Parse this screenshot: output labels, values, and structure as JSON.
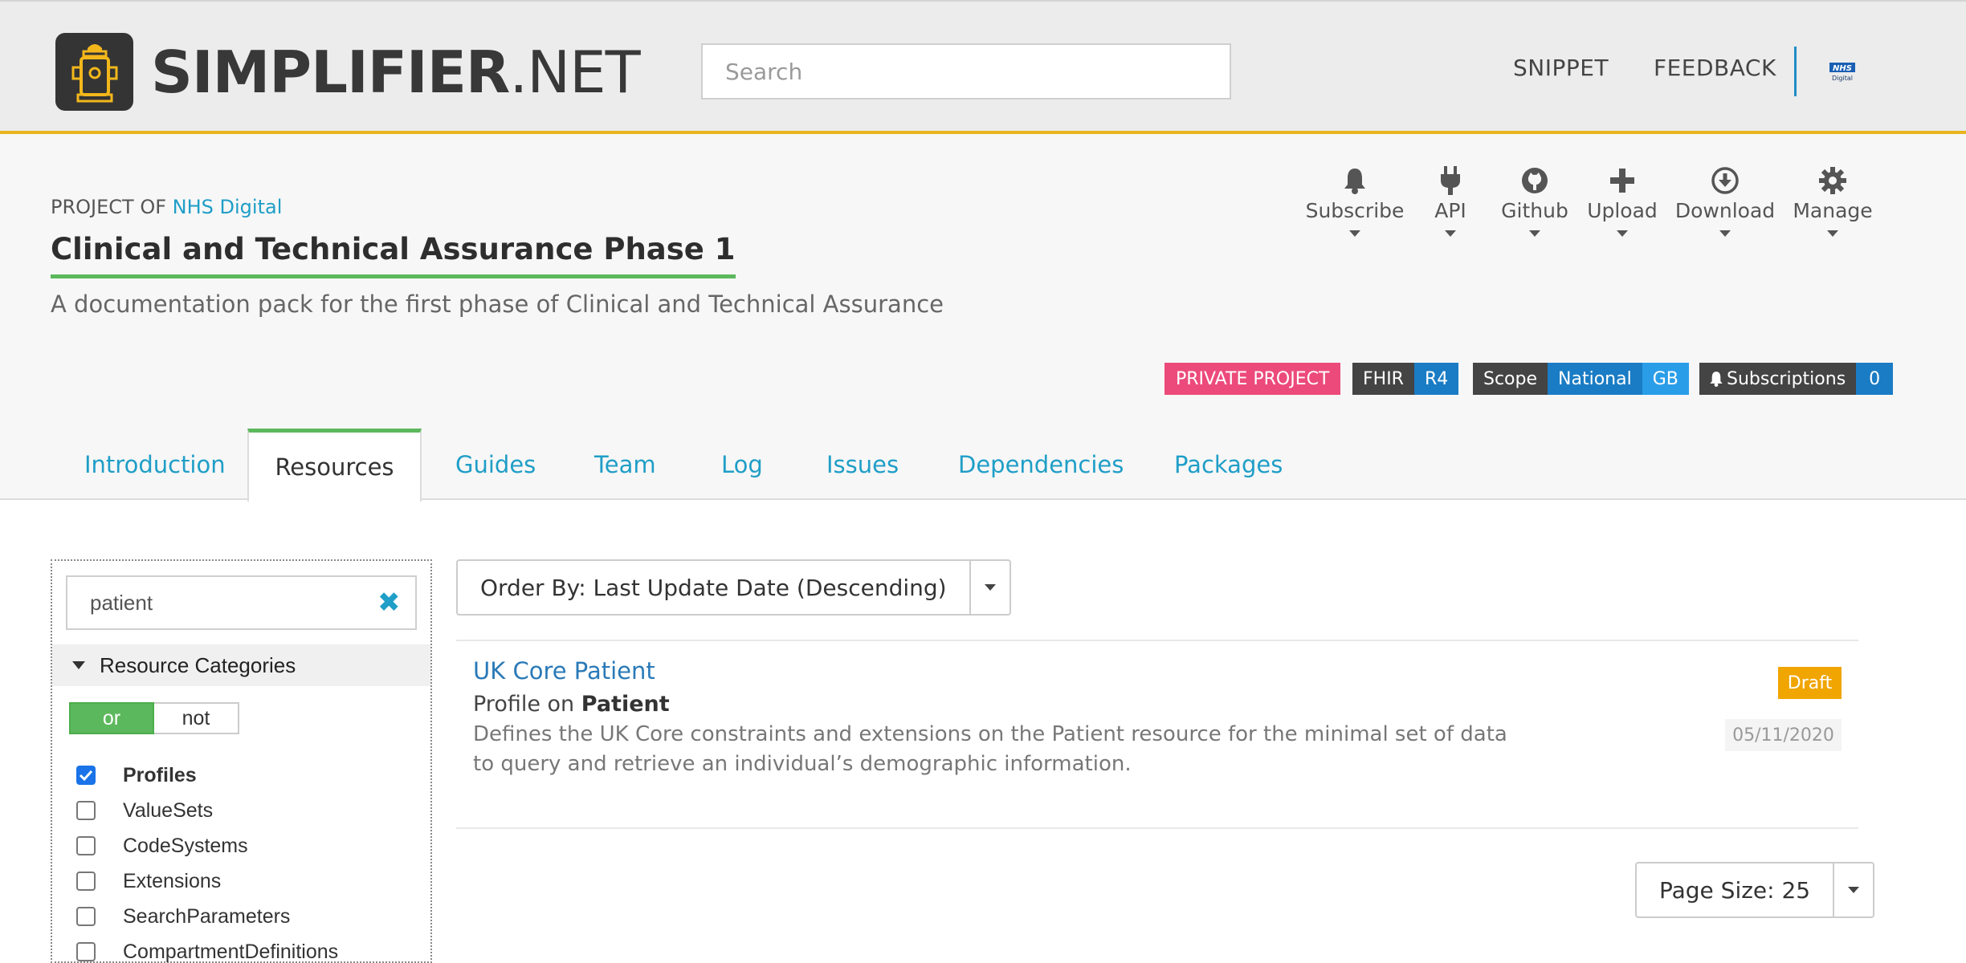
{
  "header": {
    "logo_text_bold": "SIMPLIFIER",
    "logo_text_rest": ".NET",
    "search_placeholder": "Search",
    "nav": {
      "snippet": "SNIPPET",
      "feedback": "FEEDBACK"
    },
    "org_logo_text": "NHS Digital"
  },
  "project": {
    "label_prefix": "PROJECT OF",
    "org_name": "NHS Digital",
    "title": "Clinical and Technical Assurance Phase 1",
    "description": "A documentation pack for the first phase of Clinical and Technical Assurance"
  },
  "actions": [
    {
      "label": "Subscribe",
      "icon": "bell-icon"
    },
    {
      "label": "API",
      "icon": "plug-icon"
    },
    {
      "label": "Github",
      "icon": "github-icon"
    },
    {
      "label": "Upload",
      "icon": "plus-icon"
    },
    {
      "label": "Download",
      "icon": "download-icon"
    },
    {
      "label": "Manage",
      "icon": "gear-icon"
    }
  ],
  "badges": {
    "private": "PRIVATE PROJECT",
    "fhir": {
      "label": "FHIR",
      "value": "R4"
    },
    "scope": {
      "label": "Scope",
      "value": "National",
      "extra": "GB"
    },
    "subscriptions": {
      "label": "Subscriptions",
      "value": "0"
    }
  },
  "tabs": [
    {
      "label": "Introduction"
    },
    {
      "label": "Resources",
      "active": true
    },
    {
      "label": "Guides"
    },
    {
      "label": "Team"
    },
    {
      "label": "Log"
    },
    {
      "label": "Issues"
    },
    {
      "label": "Dependencies"
    },
    {
      "label": "Packages"
    }
  ],
  "filter": {
    "query": "patient",
    "categories_heading": "Resource Categories",
    "toggle": {
      "on": "or",
      "off": "not"
    },
    "categories": [
      {
        "label": "Profiles",
        "checked": true
      },
      {
        "label": "ValueSets",
        "checked": false
      },
      {
        "label": "CodeSystems",
        "checked": false
      },
      {
        "label": "Extensions",
        "checked": false
      },
      {
        "label": "SearchParameters",
        "checked": false
      },
      {
        "label": "CompartmentDefinitions",
        "checked": false
      }
    ]
  },
  "results": {
    "order_by": "Order By: Last Update Date (Descending)",
    "items": [
      {
        "title": "UK Core Patient",
        "type_prefix": "Profile on",
        "type_name": "Patient",
        "description": "Defines the UK Core constraints and extensions on the Patient resource for the minimal set of data to query and retrieve an individual’s demographic information.",
        "status": "Draft",
        "date": "05/11/2020"
      }
    ],
    "page_size": "Page Size: 25"
  },
  "colors": {
    "accent": "#1f9ec7",
    "green": "#5cb85c",
    "header_border": "#e8b520",
    "private_badge": "#ec4a7b",
    "draft_badge": "#f0a500"
  }
}
